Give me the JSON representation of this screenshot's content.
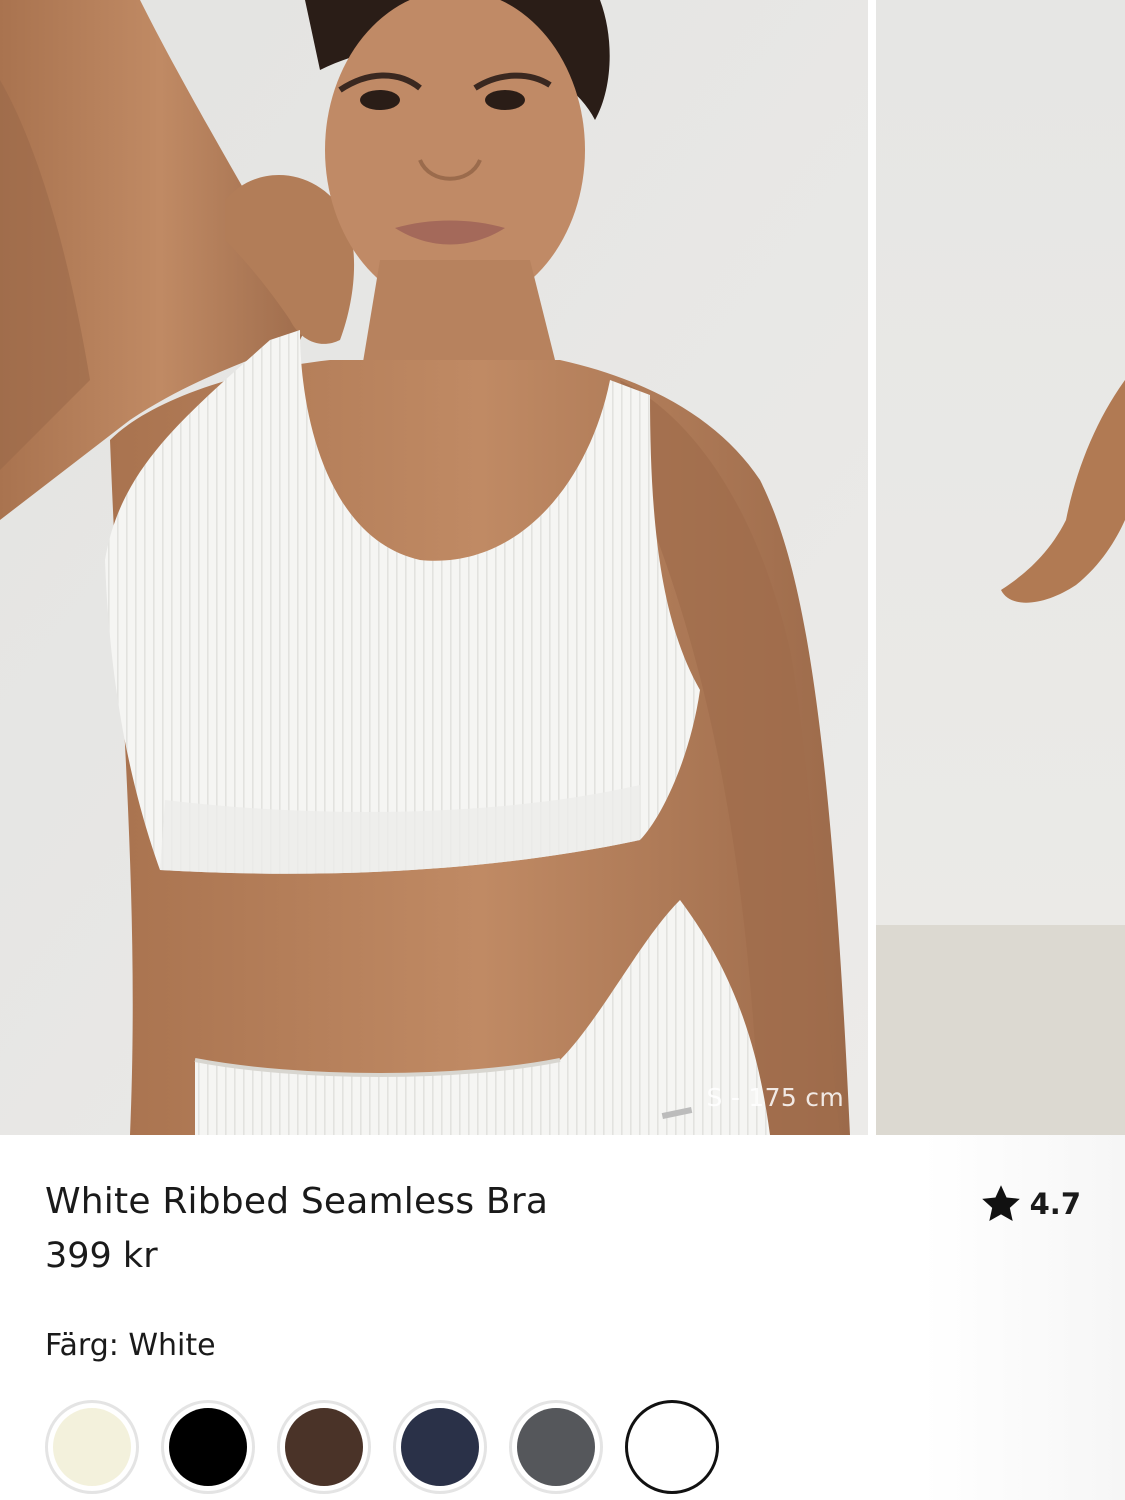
{
  "gallery": {
    "model_caption": "S - 175 cm"
  },
  "product": {
    "name": "White Ribbed Seamless Bra",
    "price": "399 kr",
    "rating": "4.7",
    "rating_icon": "star-icon",
    "color_label": "Färg: White"
  },
  "swatches": [
    {
      "name": "cream",
      "color": "#f3f1dc",
      "selected": false
    },
    {
      "name": "black",
      "color": "#000000",
      "selected": false
    },
    {
      "name": "brown",
      "color": "#4a3328",
      "selected": false
    },
    {
      "name": "navy",
      "color": "#2a3148",
      "selected": false
    },
    {
      "name": "grey",
      "color": "#55575b",
      "selected": false
    },
    {
      "name": "white",
      "color": "#ffffff",
      "selected": true
    }
  ]
}
